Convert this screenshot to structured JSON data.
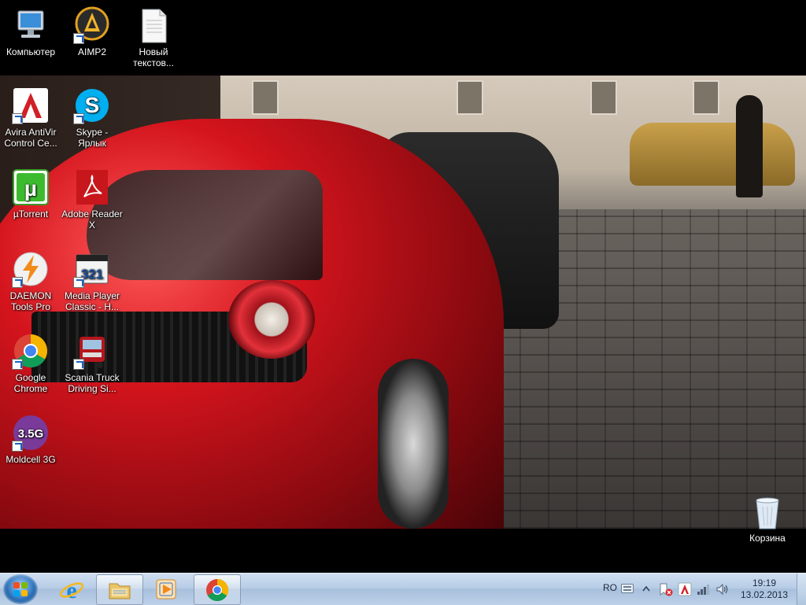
{
  "desktop": {
    "top_icons": [
      {
        "label": "Компьютер",
        "icon": "computer-icon"
      },
      {
        "label": "AIMP2",
        "icon": "aimp2-icon"
      },
      {
        "label": "Новый текстов...",
        "icon": "text-document-icon"
      }
    ],
    "icons": [
      {
        "label": "Avira AntiVir Control Ce...",
        "icon": "avira-icon"
      },
      {
        "label": "Skype - Ярлык",
        "icon": "skype-icon"
      },
      {
        "label": "µTorrent",
        "icon": "utorrent-icon"
      },
      {
        "label": "Adobe Reader X",
        "icon": "adobe-reader-icon"
      },
      {
        "label": "DAEMON Tools Pro",
        "icon": "daemon-tools-icon"
      },
      {
        "label": "Media Player Classic - H...",
        "icon": "media-player-classic-icon"
      },
      {
        "label": "Google Chrome",
        "icon": "chrome-icon"
      },
      {
        "label": "Scania Truck Driving Si...",
        "icon": "scania-truck-icon"
      },
      {
        "label": "Moldcell 3G",
        "icon": "moldcell-icon"
      }
    ],
    "recycle_bin": {
      "label": "Корзина",
      "icon": "recycle-bin-icon"
    },
    "moldcell_badge": "3.5G",
    "torrent_glyph": "µ",
    "mpc_badge": "321"
  },
  "taskbar": {
    "pinned": [
      {
        "name": "internet-explorer",
        "icon": "ie-icon"
      },
      {
        "name": "windows-explorer",
        "icon": "folder-icon"
      },
      {
        "name": "media-player",
        "icon": "media-player-icon"
      },
      {
        "name": "google-chrome",
        "icon": "chrome-icon"
      }
    ],
    "language": "RO",
    "time": "19:19",
    "date": "13.02.2013"
  },
  "colors": {
    "taskbar_bg": "#b7cde6",
    "desktop_bg": "#000000",
    "accent_red": "#d4141d"
  }
}
